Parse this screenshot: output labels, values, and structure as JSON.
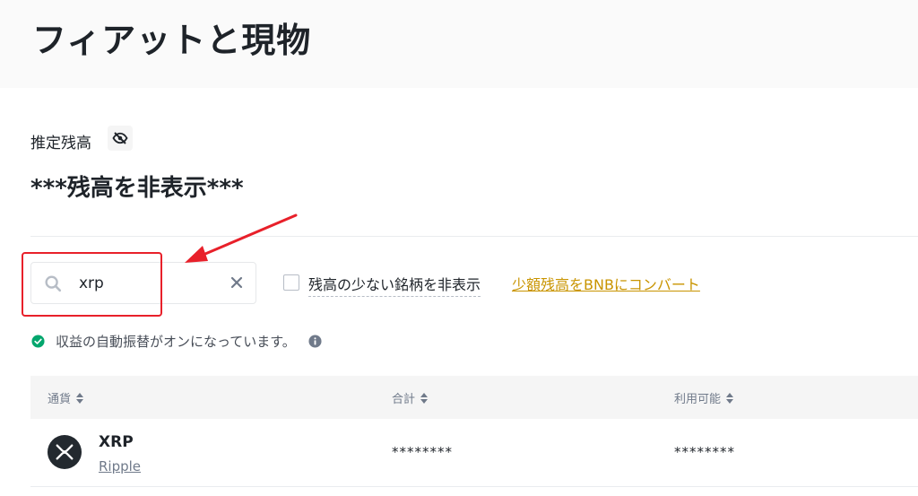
{
  "header": {
    "title": "フィアットと現物"
  },
  "balance": {
    "label": "推定残高",
    "hidden_text": "***残高を非表示***",
    "toggle_icon": "eye-slash-icon"
  },
  "search": {
    "value": "xrp",
    "placeholder": ""
  },
  "filters": {
    "hide_small_label": "残高の少ない銘柄を非表示",
    "hide_small_checked": false,
    "convert_link": "少額残高をBNBにコンバート"
  },
  "notice": {
    "text": "収益の自動振替がオンになっています。"
  },
  "table": {
    "columns": [
      {
        "label": "通貨"
      },
      {
        "label": "合計"
      },
      {
        "label": "利用可能"
      }
    ],
    "rows": [
      {
        "symbol": "XRP",
        "name": "Ripple",
        "total": "********",
        "available": "********"
      }
    ]
  },
  "colors": {
    "accent_link": "#c99400",
    "annotation_red": "#e8202a",
    "success_green": "#03a66d",
    "text_primary": "#1e2329"
  }
}
